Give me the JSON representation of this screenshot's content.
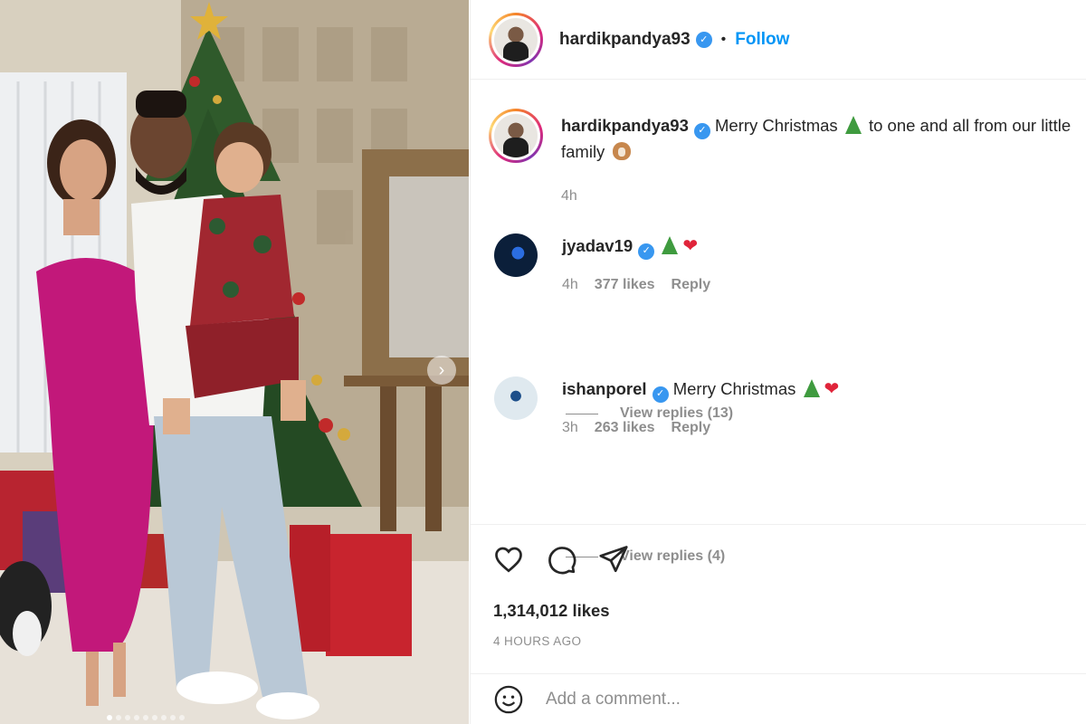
{
  "post": {
    "image_alt": "Family Christmas photo in front of a decorated tree",
    "carousel_total": 9,
    "carousel_active": 1,
    "next_icon": "chevron-right-icon"
  },
  "header": {
    "username": "hardikpandya93",
    "separator": "•",
    "follow_label": "Follow",
    "verified_icon": "verified-badge-icon"
  },
  "caption": {
    "username": "hardikpandya93",
    "text_before": " Merry Christmas ",
    "text_after": " to one and all from our little family ",
    "time": "4h"
  },
  "comments": [
    {
      "username": "jyadav19",
      "time": "4h",
      "likes": "377 likes",
      "reply": "Reply",
      "view_replies": "View replies (13)",
      "avatar_color": "#0b1f3a"
    },
    {
      "username": "ishanporel",
      "text": " Merry Christmas ",
      "time": "3h",
      "likes": "263 likes",
      "reply": "Reply",
      "view_replies": "View replies (4)",
      "avatar_color": "#dfe9ef"
    }
  ],
  "actions": {
    "like_icon": "heart-icon",
    "comment_icon": "comment-icon",
    "share_icon": "send-icon"
  },
  "likes_count": "1,314,012 likes",
  "posted_ago": "4 HOURS AGO",
  "composer": {
    "placeholder": "Add a comment...",
    "emoji_icon": "smiley-icon"
  },
  "colors": {
    "link_blue": "#0095f6",
    "verified_blue": "#3897f0",
    "muted": "#8e8e8e"
  }
}
